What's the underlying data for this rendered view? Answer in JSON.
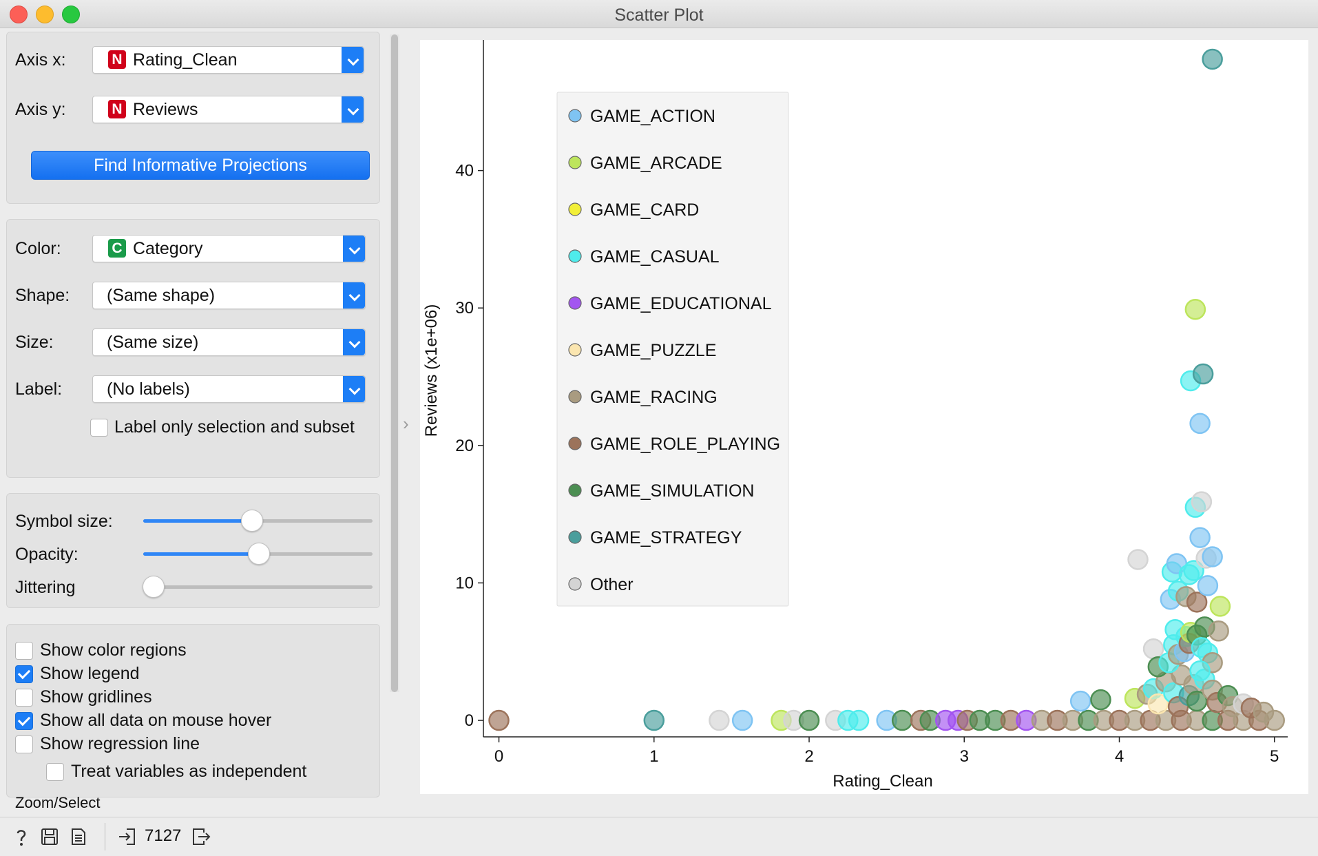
{
  "window": {
    "title": "Scatter Plot"
  },
  "axes_panel": {
    "axis_x_label": "Axis x:",
    "axis_x_value": "Rating_Clean",
    "axis_x_badge": "N",
    "axis_y_label": "Axis y:",
    "axis_y_value": "Reviews",
    "axis_y_badge": "N",
    "find_button": "Find Informative Projections"
  },
  "attributes_panel": {
    "color_label": "Color:",
    "color_value": "Category",
    "color_badge": "C",
    "shape_label": "Shape:",
    "shape_value": "(Same shape)",
    "size_label": "Size:",
    "size_value": "(Same size)",
    "label_label": "Label:",
    "label_value": "(No labels)",
    "label_only_text": "Label only selection and subset",
    "label_only_checked": false
  },
  "sliders_panel": {
    "symbol_size_label": "Symbol size:",
    "symbol_size_level": 0.47,
    "opacity_label": "Opacity:",
    "opacity_level": 0.5,
    "jittering_label": "Jittering",
    "jittering_level": 0.0
  },
  "options_panel": {
    "show_color_regions": "Show color regions",
    "show_legend": "Show legend",
    "show_gridlines": "Show gridlines",
    "show_all_data": "Show all data on mouse hover",
    "show_regression": "Show regression line",
    "treat_independent": "Treat variables as independent",
    "checked": [
      false,
      true,
      false,
      true,
      false,
      false
    ]
  },
  "zoom_select_label": "Zoom/Select",
  "status": {
    "count": "7127"
  },
  "icons": [
    "help-icon",
    "save-icon",
    "report-icon",
    "input-icon",
    "output-icon"
  ],
  "colors": {
    "accent": "#1d7ef6",
    "numeric_badge": "#d0021b",
    "categorical_badge": "#1a9b4a"
  },
  "chart_data": {
    "type": "scatter",
    "xlabel": "Rating_Clean",
    "ylabel": "Reviews (x1e+06)",
    "xlim": [
      -0.1,
      5.05
    ],
    "ylim": [
      -1.2,
      49.5
    ],
    "xticks": [
      0,
      1,
      2,
      3,
      4,
      5
    ],
    "yticks": [
      0,
      10,
      20,
      30,
      40
    ],
    "grid": false,
    "legend_position": "top-left",
    "legend": [
      {
        "name": "GAME_ACTION",
        "color": "#7fc4f3"
      },
      {
        "name": "GAME_ARCADE",
        "color": "#bde55c"
      },
      {
        "name": "GAME_CARD",
        "color": "#f2ef38"
      },
      {
        "name": "GAME_CASUAL",
        "color": "#4fecec"
      },
      {
        "name": "GAME_EDUCATIONAL",
        "color": "#a355f0"
      },
      {
        "name": "GAME_PUZZLE",
        "color": "#fbe6b0"
      },
      {
        "name": "GAME_RACING",
        "color": "#a99b80"
      },
      {
        "name": "GAME_ROLE_PLAYING",
        "color": "#9c735b"
      },
      {
        "name": "GAME_SIMULATION",
        "color": "#4c8e52"
      },
      {
        "name": "GAME_STRATEGY",
        "color": "#4a9e9c"
      },
      {
        "name": "Other",
        "color": "#d4d4d4"
      }
    ],
    "points": [
      {
        "x": 0.0,
        "y": 0.0,
        "c": 7
      },
      {
        "x": 1.0,
        "y": 0.0,
        "c": 9
      },
      {
        "x": 1.42,
        "y": 0.0,
        "c": 10
      },
      {
        "x": 1.57,
        "y": 0.0,
        "c": 0
      },
      {
        "x": 1.82,
        "y": 0.0,
        "c": 1
      },
      {
        "x": 1.9,
        "y": 0.0,
        "c": 10
      },
      {
        "x": 2.0,
        "y": 0.0,
        "c": 8
      },
      {
        "x": 2.17,
        "y": 0.0,
        "c": 10
      },
      {
        "x": 2.25,
        "y": 0.0,
        "c": 3
      },
      {
        "x": 2.32,
        "y": 0.0,
        "c": 3
      },
      {
        "x": 2.5,
        "y": 0.0,
        "c": 0
      },
      {
        "x": 2.6,
        "y": 0.0,
        "c": 8
      },
      {
        "x": 2.72,
        "y": 0.0,
        "c": 7
      },
      {
        "x": 2.78,
        "y": 0.0,
        "c": 8
      },
      {
        "x": 2.88,
        "y": 0.0,
        "c": 4
      },
      {
        "x": 2.96,
        "y": 0.0,
        "c": 4
      },
      {
        "x": 3.02,
        "y": 0.0,
        "c": 7
      },
      {
        "x": 3.1,
        "y": 0.0,
        "c": 8
      },
      {
        "x": 3.2,
        "y": 0.0,
        "c": 8
      },
      {
        "x": 3.3,
        "y": 0.0,
        "c": 7
      },
      {
        "x": 3.4,
        "y": 0.0,
        "c": 4
      },
      {
        "x": 3.5,
        "y": 0.0,
        "c": 6
      },
      {
        "x": 3.6,
        "y": 0.0,
        "c": 7
      },
      {
        "x": 3.7,
        "y": 0.0,
        "c": 6
      },
      {
        "x": 3.8,
        "y": 0.0,
        "c": 8
      },
      {
        "x": 3.9,
        "y": 0.0,
        "c": 6
      },
      {
        "x": 4.0,
        "y": 0.0,
        "c": 7
      },
      {
        "x": 4.1,
        "y": 0.0,
        "c": 6
      },
      {
        "x": 4.2,
        "y": 0.0,
        "c": 7
      },
      {
        "x": 4.3,
        "y": 0.0,
        "c": 6
      },
      {
        "x": 4.4,
        "y": 0.0,
        "c": 7
      },
      {
        "x": 4.5,
        "y": 0.0,
        "c": 6
      },
      {
        "x": 4.6,
        "y": 0.0,
        "c": 8
      },
      {
        "x": 4.7,
        "y": 0.0,
        "c": 7
      },
      {
        "x": 4.8,
        "y": 0.0,
        "c": 6
      },
      {
        "x": 4.9,
        "y": 0.0,
        "c": 7
      },
      {
        "x": 5.0,
        "y": 0.0,
        "c": 6
      },
      {
        "x": 3.75,
        "y": 1.4,
        "c": 0
      },
      {
        "x": 3.88,
        "y": 1.5,
        "c": 8
      },
      {
        "x": 4.1,
        "y": 1.6,
        "c": 1
      },
      {
        "x": 4.18,
        "y": 1.9,
        "c": 6
      },
      {
        "x": 4.22,
        "y": 2.3,
        "c": 3
      },
      {
        "x": 4.25,
        "y": 1.2,
        "c": 5
      },
      {
        "x": 4.3,
        "y": 2.8,
        "c": 6
      },
      {
        "x": 4.35,
        "y": 2.0,
        "c": 3
      },
      {
        "x": 4.38,
        "y": 1.0,
        "c": 7
      },
      {
        "x": 4.4,
        "y": 3.3,
        "c": 6
      },
      {
        "x": 4.45,
        "y": 1.8,
        "c": 9
      },
      {
        "x": 4.48,
        "y": 2.6,
        "c": 6
      },
      {
        "x": 4.5,
        "y": 1.4,
        "c": 8
      },
      {
        "x": 4.55,
        "y": 3.0,
        "c": 3
      },
      {
        "x": 4.6,
        "y": 2.2,
        "c": 6
      },
      {
        "x": 4.63,
        "y": 1.3,
        "c": 7
      },
      {
        "x": 4.7,
        "y": 1.8,
        "c": 8
      },
      {
        "x": 4.73,
        "y": 1.0,
        "c": 6
      },
      {
        "x": 4.8,
        "y": 1.2,
        "c": 10
      },
      {
        "x": 4.85,
        "y": 0.9,
        "c": 7
      },
      {
        "x": 4.93,
        "y": 0.6,
        "c": 6
      },
      {
        "x": 4.22,
        "y": 5.2,
        "c": 10
      },
      {
        "x": 4.25,
        "y": 3.9,
        "c": 8
      },
      {
        "x": 4.32,
        "y": 4.2,
        "c": 3
      },
      {
        "x": 4.35,
        "y": 5.5,
        "c": 3
      },
      {
        "x": 4.36,
        "y": 6.6,
        "c": 3
      },
      {
        "x": 4.38,
        "y": 4.8,
        "c": 6
      },
      {
        "x": 4.42,
        "y": 5.0,
        "c": 0
      },
      {
        "x": 4.43,
        "y": 6.1,
        "c": 3
      },
      {
        "x": 4.45,
        "y": 5.6,
        "c": 7
      },
      {
        "x": 4.46,
        "y": 6.4,
        "c": 1
      },
      {
        "x": 4.5,
        "y": 6.2,
        "c": 8
      },
      {
        "x": 4.53,
        "y": 5.3,
        "c": 3
      },
      {
        "x": 4.55,
        "y": 6.8,
        "c": 8
      },
      {
        "x": 4.57,
        "y": 4.9,
        "c": 3
      },
      {
        "x": 4.6,
        "y": 4.2,
        "c": 6
      },
      {
        "x": 4.64,
        "y": 6.5,
        "c": 6
      },
      {
        "x": 4.52,
        "y": 3.6,
        "c": 3
      },
      {
        "x": 4.33,
        "y": 8.8,
        "c": 0
      },
      {
        "x": 4.38,
        "y": 9.4,
        "c": 3
      },
      {
        "x": 4.43,
        "y": 9.0,
        "c": 6
      },
      {
        "x": 4.5,
        "y": 8.6,
        "c": 7
      },
      {
        "x": 4.57,
        "y": 9.8,
        "c": 0
      },
      {
        "x": 4.65,
        "y": 8.3,
        "c": 1
      },
      {
        "x": 4.34,
        "y": 10.8,
        "c": 3
      },
      {
        "x": 4.37,
        "y": 11.4,
        "c": 0
      },
      {
        "x": 4.45,
        "y": 10.6,
        "c": 3
      },
      {
        "x": 4.48,
        "y": 10.9,
        "c": 3
      },
      {
        "x": 4.12,
        "y": 11.7,
        "c": 10
      },
      {
        "x": 4.56,
        "y": 11.8,
        "c": 10
      },
      {
        "x": 4.6,
        "y": 11.9,
        "c": 0
      },
      {
        "x": 4.52,
        "y": 13.3,
        "c": 0
      },
      {
        "x": 4.49,
        "y": 15.5,
        "c": 3
      },
      {
        "x": 4.53,
        "y": 15.9,
        "c": 10
      },
      {
        "x": 4.52,
        "y": 21.6,
        "c": 0
      },
      {
        "x": 4.46,
        "y": 24.7,
        "c": 3
      },
      {
        "x": 4.54,
        "y": 25.2,
        "c": 9
      },
      {
        "x": 4.49,
        "y": 29.9,
        "c": 1
      },
      {
        "x": 4.6,
        "y": 48.1,
        "c": 9
      }
    ]
  }
}
